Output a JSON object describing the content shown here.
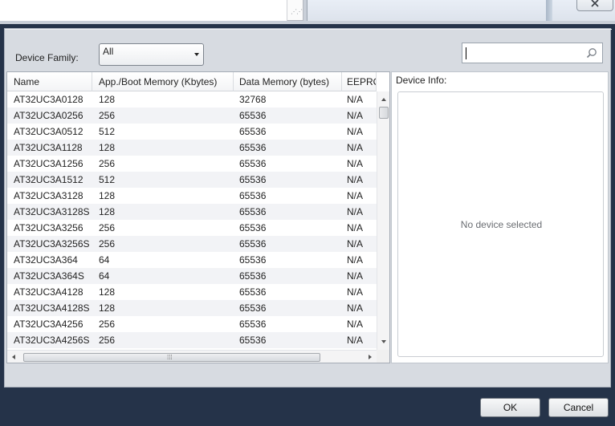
{
  "filter": {
    "family_label": "Device Family:",
    "family_value": "All",
    "search_value": ""
  },
  "table": {
    "columns": [
      "Name",
      "App./Boot Memory (Kbytes)",
      "Data Memory (bytes)",
      "EEPROM"
    ],
    "rows": [
      [
        "AT32UC3A0128",
        "128",
        "32768",
        "N/A"
      ],
      [
        "AT32UC3A0256",
        "256",
        "65536",
        "N/A"
      ],
      [
        "AT32UC3A0512",
        "512",
        "65536",
        "N/A"
      ],
      [
        "AT32UC3A1128",
        "128",
        "65536",
        "N/A"
      ],
      [
        "AT32UC3A1256",
        "256",
        "65536",
        "N/A"
      ],
      [
        "AT32UC3A1512",
        "512",
        "65536",
        "N/A"
      ],
      [
        "AT32UC3A3128",
        "128",
        "65536",
        "N/A"
      ],
      [
        "AT32UC3A3128S",
        "128",
        "65536",
        "N/A"
      ],
      [
        "AT32UC3A3256",
        "256",
        "65536",
        "N/A"
      ],
      [
        "AT32UC3A3256S",
        "256",
        "65536",
        "N/A"
      ],
      [
        "AT32UC3A364",
        "64",
        "65536",
        "N/A"
      ],
      [
        "AT32UC3A364S",
        "64",
        "65536",
        "N/A"
      ],
      [
        "AT32UC3A4128",
        "128",
        "65536",
        "N/A"
      ],
      [
        "AT32UC3A4128S",
        "128",
        "65536",
        "N/A"
      ],
      [
        "AT32UC3A4256",
        "256",
        "65536",
        "N/A"
      ],
      [
        "AT32UC3A4256S",
        "256",
        "65536",
        "N/A"
      ]
    ]
  },
  "info": {
    "label": "Device Info:",
    "empty_text": "No device selected"
  },
  "buttons": {
    "ok": "OK",
    "cancel": "Cancel"
  }
}
